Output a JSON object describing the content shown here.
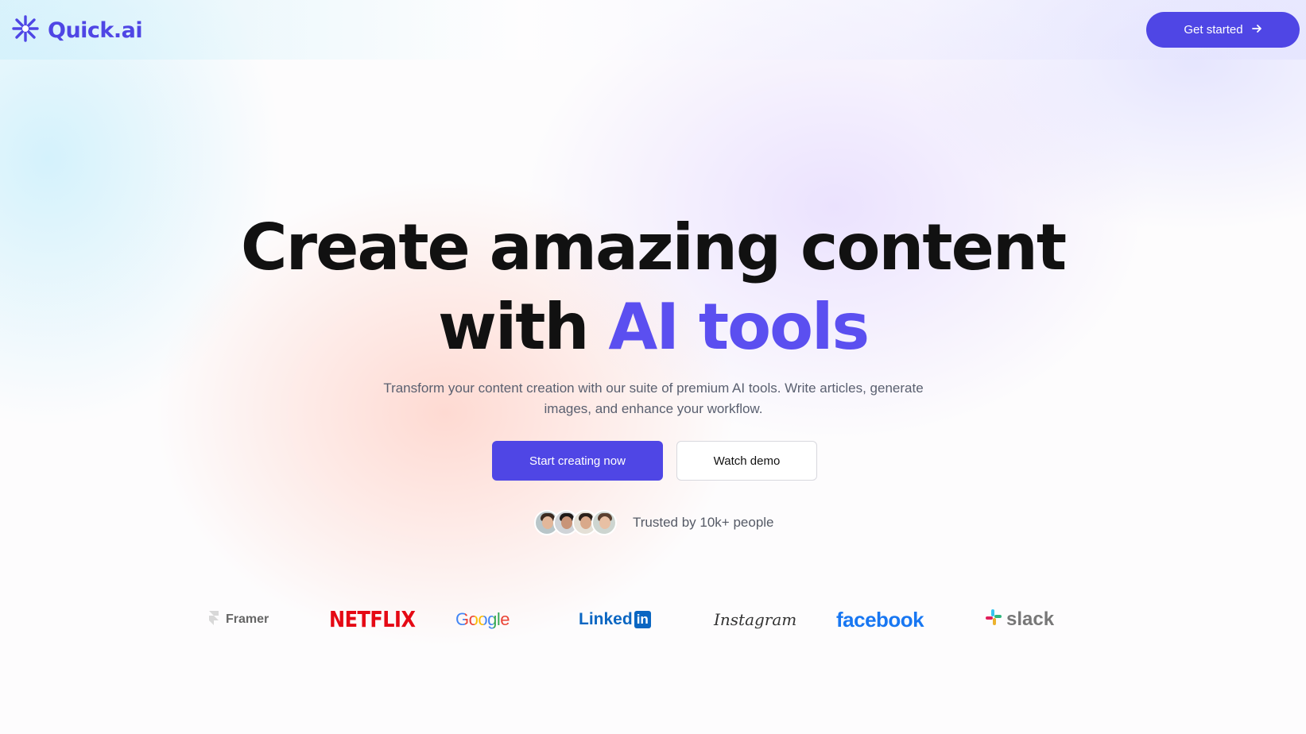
{
  "brand": {
    "name": "Quick.ai",
    "logo_icon": "sparkle-asterisk-icon",
    "accent_color": "#4f46e5"
  },
  "nav": {
    "cta_label": "Get started",
    "cta_icon": "arrow-right-icon"
  },
  "hero": {
    "headline_line1": "Create amazing content",
    "headline_line2_prefix": "with",
    "headline_line2_accent": "AI tools",
    "subtitle": "Transform your content creation with our suite of premium AI tools. Write articles, generate images, and enhance your workflow.",
    "primary_button": "Start creating now",
    "secondary_button": "Watch demo",
    "trust_text": "Trusted by 10k+ people"
  },
  "partner_logos": [
    {
      "name": "Framer",
      "color": "#666666"
    },
    {
      "name": "NETFLIX",
      "color": "#e50914"
    },
    {
      "name": "Google",
      "color": "#4285f4"
    },
    {
      "name": "Linked",
      "suffix": "in",
      "color": "#0a66c2"
    },
    {
      "name": "Instagram",
      "color": "#333333"
    },
    {
      "name": "facebook",
      "color": "#1877f2"
    },
    {
      "name": "slack",
      "color": "#777777"
    }
  ]
}
